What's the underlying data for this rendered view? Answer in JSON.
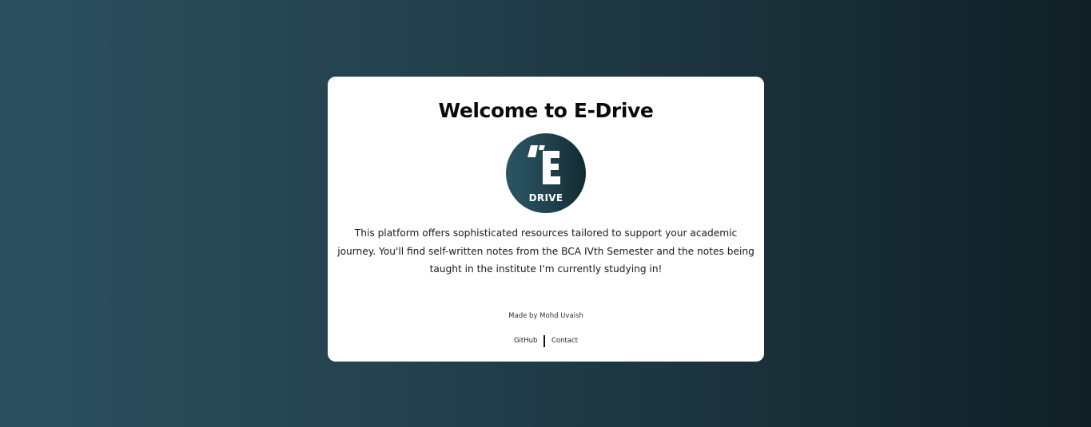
{
  "card": {
    "title": "Welcome to E-Drive",
    "logo": {
      "letter": "E",
      "word": "DRIVE",
      "icon": "e-drive-logo"
    },
    "description": "This platform offers sophisticated resources tailored to support your academic journey. You'll find self-written notes from the BCA IVth Semester and the notes being taught in the institute I'm currently studying in!",
    "credit": "Made by Mohd Uvaish",
    "links": {
      "github": "GitHub",
      "contact": "Contact"
    }
  },
  "colors": {
    "background_left": "#2a5060",
    "background_right": "#0f1f25",
    "card": "#ffffff",
    "logo_circle": "#214450"
  }
}
